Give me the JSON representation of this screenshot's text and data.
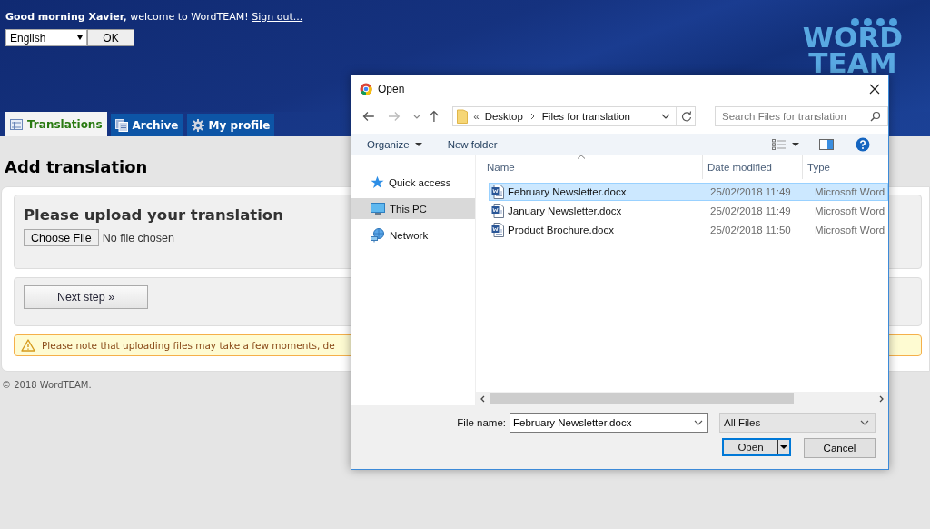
{
  "header": {
    "greeting": "**Good morning Xavier,** welcome to WordTEAM!",
    "sign_out": "Sign out...",
    "language_select": {
      "value": "English"
    },
    "ok_button": "OK",
    "logo": {
      "line_1": "WORD",
      "line_2": "TEAM"
    }
  },
  "tabs": [
    {
      "label": "Translations",
      "selected": true
    },
    {
      "label": "Archive",
      "selected": false
    },
    {
      "label": "My profile",
      "selected": false
    }
  ],
  "page": {
    "heading": "Add translation",
    "upload_title": "Please upload your translation",
    "choose_button": "Choose File",
    "file_status": "No file chosen",
    "next_button": "Next step »",
    "notice": "Please note that uploading files may take a few moments, de",
    "footer": "© 2018 WordTEAM."
  },
  "dialog": {
    "title": "Open",
    "breadcrumb_prefix": "«",
    "breadcrumb": [
      "Desktop",
      "Files for translation"
    ],
    "search": {
      "placeholder": "Search Files for translation"
    },
    "toolbar": {
      "organize": "Organize",
      "new_folder": "New folder"
    },
    "nav_items": [
      {
        "label": "Quick access",
        "selected": false
      },
      {
        "label": "This PC",
        "selected": true
      },
      {
        "label": "Network",
        "selected": false
      }
    ],
    "columns": [
      "Name",
      "Date modified",
      "Type"
    ],
    "files": [
      {
        "name": "February Newsletter.docx",
        "date": "25/02/2018 11:49",
        "type": "Microsoft Word",
        "selected": true
      },
      {
        "name": "January Newsletter.docx",
        "date": "25/02/2018 11:49",
        "type": "Microsoft Word",
        "selected": false
      },
      {
        "name": "Product Brochure.docx",
        "date": "25/02/2018 11:50",
        "type": "Microsoft Word",
        "selected": false
      }
    ],
    "file_name_label": "File name:",
    "file_name": "February Newsletter.docx",
    "filter": "All Files",
    "open_button": "Open",
    "cancel_button": "Cancel"
  }
}
